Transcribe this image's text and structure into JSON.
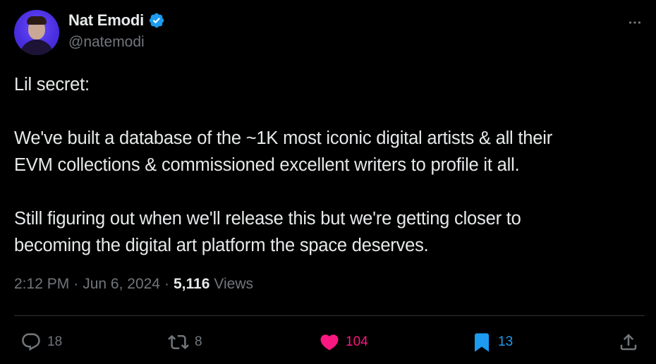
{
  "author": {
    "display_name": "Nat Emodi",
    "handle": "@natemodi",
    "verified": true
  },
  "tweet": {
    "paragraphs": [
      [
        "Lil secret:"
      ],
      [
        "We've built a database of the ~1K most iconic digital artists & all their",
        "EVM collections & commissioned excellent writers to profile it all."
      ],
      [
        "Still figuring out when we'll release this but we're getting closer to",
        "becoming the digital art platform the space deserves."
      ]
    ]
  },
  "meta": {
    "time": "2:12 PM",
    "separator": "·",
    "date": "Jun 6, 2024",
    "views_count": "5,116",
    "views_label": "Views"
  },
  "actions": {
    "replies": "18",
    "reposts": "8",
    "likes": "104",
    "bookmarks": "13"
  },
  "colors": {
    "background": "#000000",
    "text": "#e7e9ea",
    "muted": "#71767b",
    "verified": "#1d9bf0",
    "like": "#f91880",
    "bookmark": "#1d9bf0",
    "divider": "#2f3336"
  },
  "icons": {
    "more": "more-horizontal-icon",
    "reply": "reply-icon",
    "repost": "repost-icon",
    "like": "heart-icon",
    "bookmark": "bookmark-icon",
    "share": "share-icon",
    "verified": "verified-badge-icon"
  }
}
